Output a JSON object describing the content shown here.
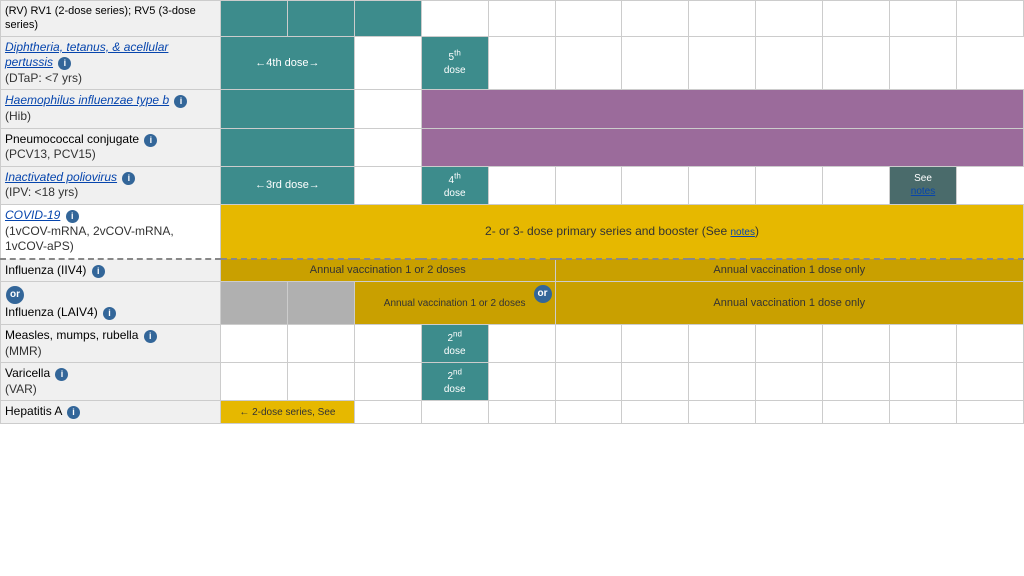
{
  "vaccines": [
    {
      "id": "rv",
      "name": "(RV) RV1 (2-dose series); RV5 (3-dose series)",
      "link": false,
      "italic": false,
      "info": false,
      "sub": null,
      "row_type": "partial_top",
      "cells": [
        {
          "span": 1,
          "color": "none",
          "text": ""
        },
        {
          "span": 1,
          "color": "none",
          "text": ""
        },
        {
          "span": 1,
          "color": "none",
          "text": ""
        },
        {
          "span": 1,
          "color": "none",
          "text": ""
        },
        {
          "span": 1,
          "color": "none",
          "text": ""
        },
        {
          "span": 1,
          "color": "none",
          "text": ""
        },
        {
          "span": 1,
          "color": "none",
          "text": ""
        },
        {
          "span": 1,
          "color": "none",
          "text": ""
        },
        {
          "span": 1,
          "color": "none",
          "text": ""
        },
        {
          "span": 1,
          "color": "none",
          "text": ""
        },
        {
          "span": 1,
          "color": "none",
          "text": ""
        },
        {
          "span": 1,
          "color": "none",
          "text": ""
        }
      ]
    },
    {
      "id": "dtap",
      "name": "Diphtheria, tetanus, & acellular pertussis",
      "link": true,
      "italic": true,
      "info": true,
      "sub": "(DTaP: <7 yrs)",
      "row_type": "normal",
      "cells": []
    },
    {
      "id": "hib",
      "name": "Haemophilus influenzae type b",
      "link": false,
      "italic": false,
      "info": true,
      "sub": "(Hib)",
      "row_type": "normal",
      "cells": []
    },
    {
      "id": "pcv",
      "name": "Pneumococcal conjugate",
      "link": false,
      "italic": false,
      "info": true,
      "sub": "(PCV13, PCV15)",
      "row_type": "normal",
      "cells": []
    },
    {
      "id": "ipv",
      "name": "Inactivated poliovirus",
      "link": true,
      "italic": true,
      "info": true,
      "sub": "(IPV: <18 yrs)",
      "row_type": "normal",
      "cells": []
    },
    {
      "id": "covid",
      "name": "COVID-19",
      "link": true,
      "italic": true,
      "info": true,
      "sub": "(1vCOV-mRNA, 2vCOV-mRNA, 1vCOV-aPS)",
      "row_type": "normal",
      "cells": []
    },
    {
      "id": "flu_iiv4",
      "name": "Influenza (IIV4)",
      "link": false,
      "italic": false,
      "info": true,
      "sub": null,
      "row_type": "dashed_top",
      "cells": []
    },
    {
      "id": "flu_laiv4",
      "name": "Influenza (LAIV4)",
      "link": false,
      "italic": false,
      "info": true,
      "sub": null,
      "row_type": "normal",
      "cells": []
    },
    {
      "id": "mmr",
      "name": "Measles, mumps, rubella",
      "link": false,
      "italic": false,
      "info": true,
      "sub": "(MMR)",
      "row_type": "normal",
      "cells": []
    },
    {
      "id": "varicella",
      "name": "Varicella",
      "link": false,
      "italic": false,
      "info": true,
      "sub": "(VAR)",
      "row_type": "normal",
      "cells": []
    },
    {
      "id": "hepa",
      "name": "Hepatitis A",
      "link": false,
      "italic": false,
      "info": true,
      "sub": null,
      "row_type": "normal",
      "cells": []
    }
  ],
  "labels": {
    "dtap_dose4": "←4th dose→",
    "dtap_dose5": "5th dose",
    "ipv_dose3": "←3rd dose→",
    "ipv_dose4": "4th dose",
    "ipv_see": "See notes",
    "covid_text": "2- or 3- dose primary series and booster (See notes)",
    "flu_iiv4_left": "Annual vaccination 1 or 2 doses",
    "flu_iiv4_right": "Annual vaccination 1 dose only",
    "flu_laiv4_left": "Annual vaccination 1 or 2 doses",
    "flu_laiv4_right": "Annual vaccination 1 dose only",
    "mmr_dose2": "2nd dose",
    "var_dose2": "2nd dose",
    "hepa_text": "← 2-dose series, See",
    "or_label": "or",
    "notes_link": "notes"
  },
  "colors": {
    "teal": "#3d8c8c",
    "dark_teal": "#2d6b6b",
    "purple": "#9b6b9b",
    "gold": "#e6b800",
    "dark_gold": "#c9a000",
    "gray": "#b0b0b0",
    "light_gray": "#d0d0d0",
    "white": "#ffffff",
    "dark_gray_teal": "#4a6b6b",
    "info_blue": "#336699",
    "bg_row": "#f0f0f0"
  }
}
